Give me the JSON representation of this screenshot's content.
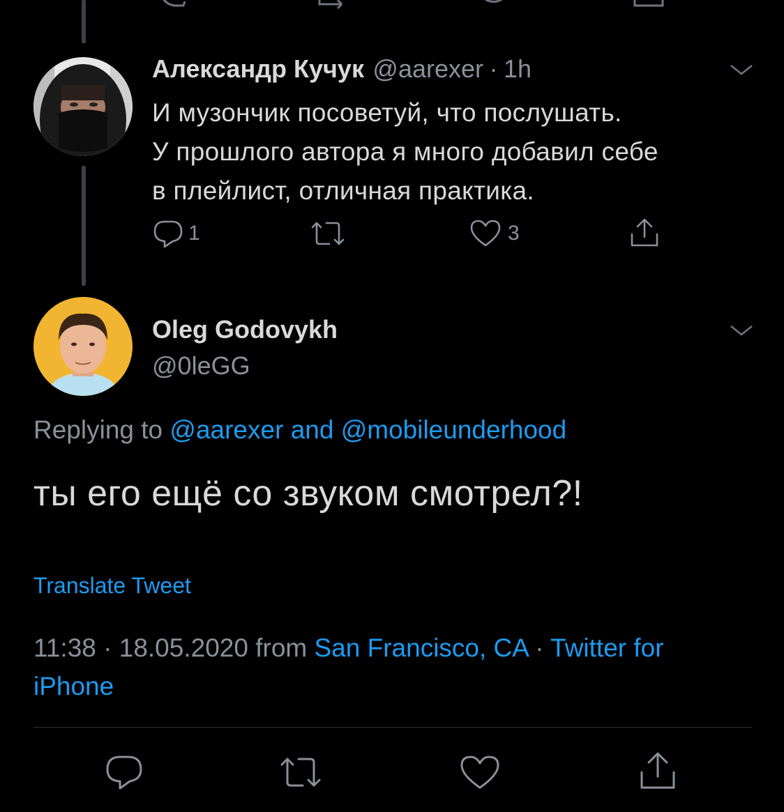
{
  "thread": {
    "top_icons": [
      "reply-icon",
      "retweet-icon",
      "like-icon",
      "share-icon"
    ]
  },
  "reply_tweet": {
    "author_name": "Александр Кучук",
    "author_handle": "@aarexer",
    "separator": "·",
    "time": "1h",
    "text": "И музончик посоветуй, что послушать.\nУ прошлого автора я много добавил себе\nв плейлист, отличная практика.",
    "replies": "1",
    "retweets": "",
    "likes": "3",
    "avatar_icon": "avatar-masked-person"
  },
  "main_tweet": {
    "author_name": "Oleg Godovykh",
    "author_handle": "@0leGG",
    "replying_prefix": "Replying to",
    "replying_to_1": "@aarexer",
    "replying_and": "and",
    "replying_to_2": "@mobileunderhood",
    "text": "ты его ещё со звуком смотрел?!",
    "translate_label": "Translate Tweet",
    "time": "11:38",
    "dot": "·",
    "date": "18.05.2020",
    "from_label": "from",
    "location": "San Francisco, CA",
    "client_dot": "·",
    "client": "Twitter for iPhone",
    "avatar_icon": "avatar-person"
  },
  "colors": {
    "background": "#000000",
    "text": "#d9d9d9",
    "secondary": "#8a9197",
    "link": "#1d9bf0",
    "divider": "#2f3336"
  }
}
